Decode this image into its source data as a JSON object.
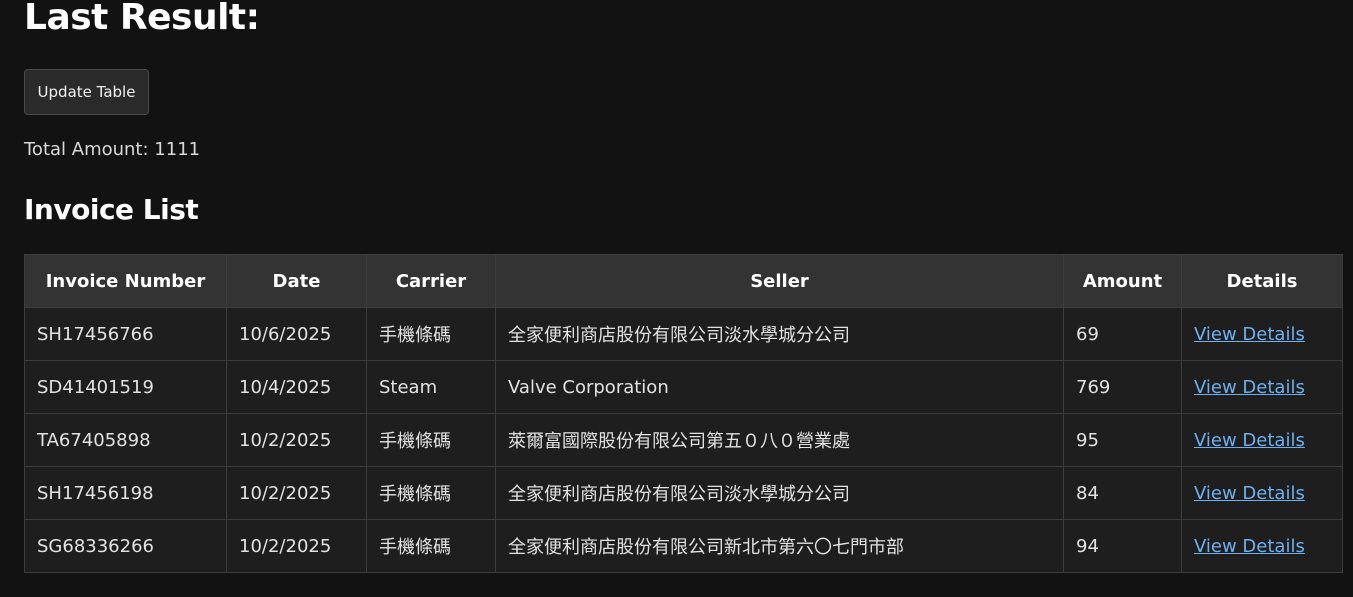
{
  "page": {
    "title": "Last Result:",
    "update_button_label": "Update Table",
    "total_label": "Total Amount:",
    "total_value": "1111",
    "invoice_list_title": "Invoice List"
  },
  "table": {
    "headers": [
      "Invoice Number",
      "Date",
      "Carrier",
      "Seller",
      "Amount",
      "Details"
    ],
    "rows": [
      {
        "invoice_number": "SH17456766",
        "date": "10/6/2025",
        "carrier": "手機條碼",
        "seller": "全家便利商店股份有限公司淡水學城分公司",
        "amount": "69",
        "details_label": "View Details"
      },
      {
        "invoice_number": "SD41401519",
        "date": "10/4/2025",
        "carrier": "Steam",
        "seller": "Valve Corporation",
        "amount": "769",
        "details_label": "View Details"
      },
      {
        "invoice_number": "TA67405898",
        "date": "10/2/2025",
        "carrier": "手機條碼",
        "seller": "萊爾富國際股份有限公司第五０八０營業處",
        "amount": "95",
        "details_label": "View Details"
      },
      {
        "invoice_number": "SH17456198",
        "date": "10/2/2025",
        "carrier": "手機條碼",
        "seller": "全家便利商店股份有限公司淡水學城分公司",
        "amount": "84",
        "details_label": "View Details"
      },
      {
        "invoice_number": "SG68336266",
        "date": "10/2/2025",
        "carrier": "手機條碼",
        "seller": "全家便利商店股份有限公司新北市第六〇七門市部",
        "amount": "94",
        "details_label": "View Details"
      }
    ]
  },
  "colors": {
    "background": "#121212",
    "header_bg": "#333333",
    "cell_bg": "#1e1e1e",
    "link": "#6fb0f0"
  }
}
